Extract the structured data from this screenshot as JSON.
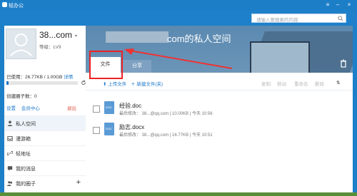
{
  "window": {
    "title": "轻办公",
    "search_placeholder": "请输入要搜索的内容"
  },
  "user": {
    "name": "38...com -",
    "level_label": "等级：LV9",
    "usage_label": "已使用：26.77KB / 1.00GB",
    "usage_detail": "详情",
    "usage_fraction": 0.026,
    "circles_label": "创建圈子数：0"
  },
  "links": {
    "settings": "设置",
    "member": "会员中心",
    "logout": "退出"
  },
  "nav": [
    {
      "label": "私人空间"
    },
    {
      "label": "漫游箱"
    },
    {
      "label": "轻地址"
    },
    {
      "label": "我的消息"
    },
    {
      "label": "我的圈子"
    }
  ],
  "space": {
    "title": "com的私人空间",
    "tab_file": "文件",
    "tab_share": "分享"
  },
  "toolbar": {
    "upload": "上传文件",
    "new": "新建文件(夹)",
    "copy": "复制",
    "move": "移动",
    "rename": "重命名",
    "delete": "删除"
  },
  "files": [
    {
      "name": "经验.doc",
      "type": "DOC",
      "meta": "最后修改：  38...@qq.com | 10.00KB | 今天 10:56"
    },
    {
      "name": "励志.docx",
      "type": "DOC",
      "meta": "最后修改：  38...@qq.com | 16.77KB | 今天 10:51"
    }
  ]
}
